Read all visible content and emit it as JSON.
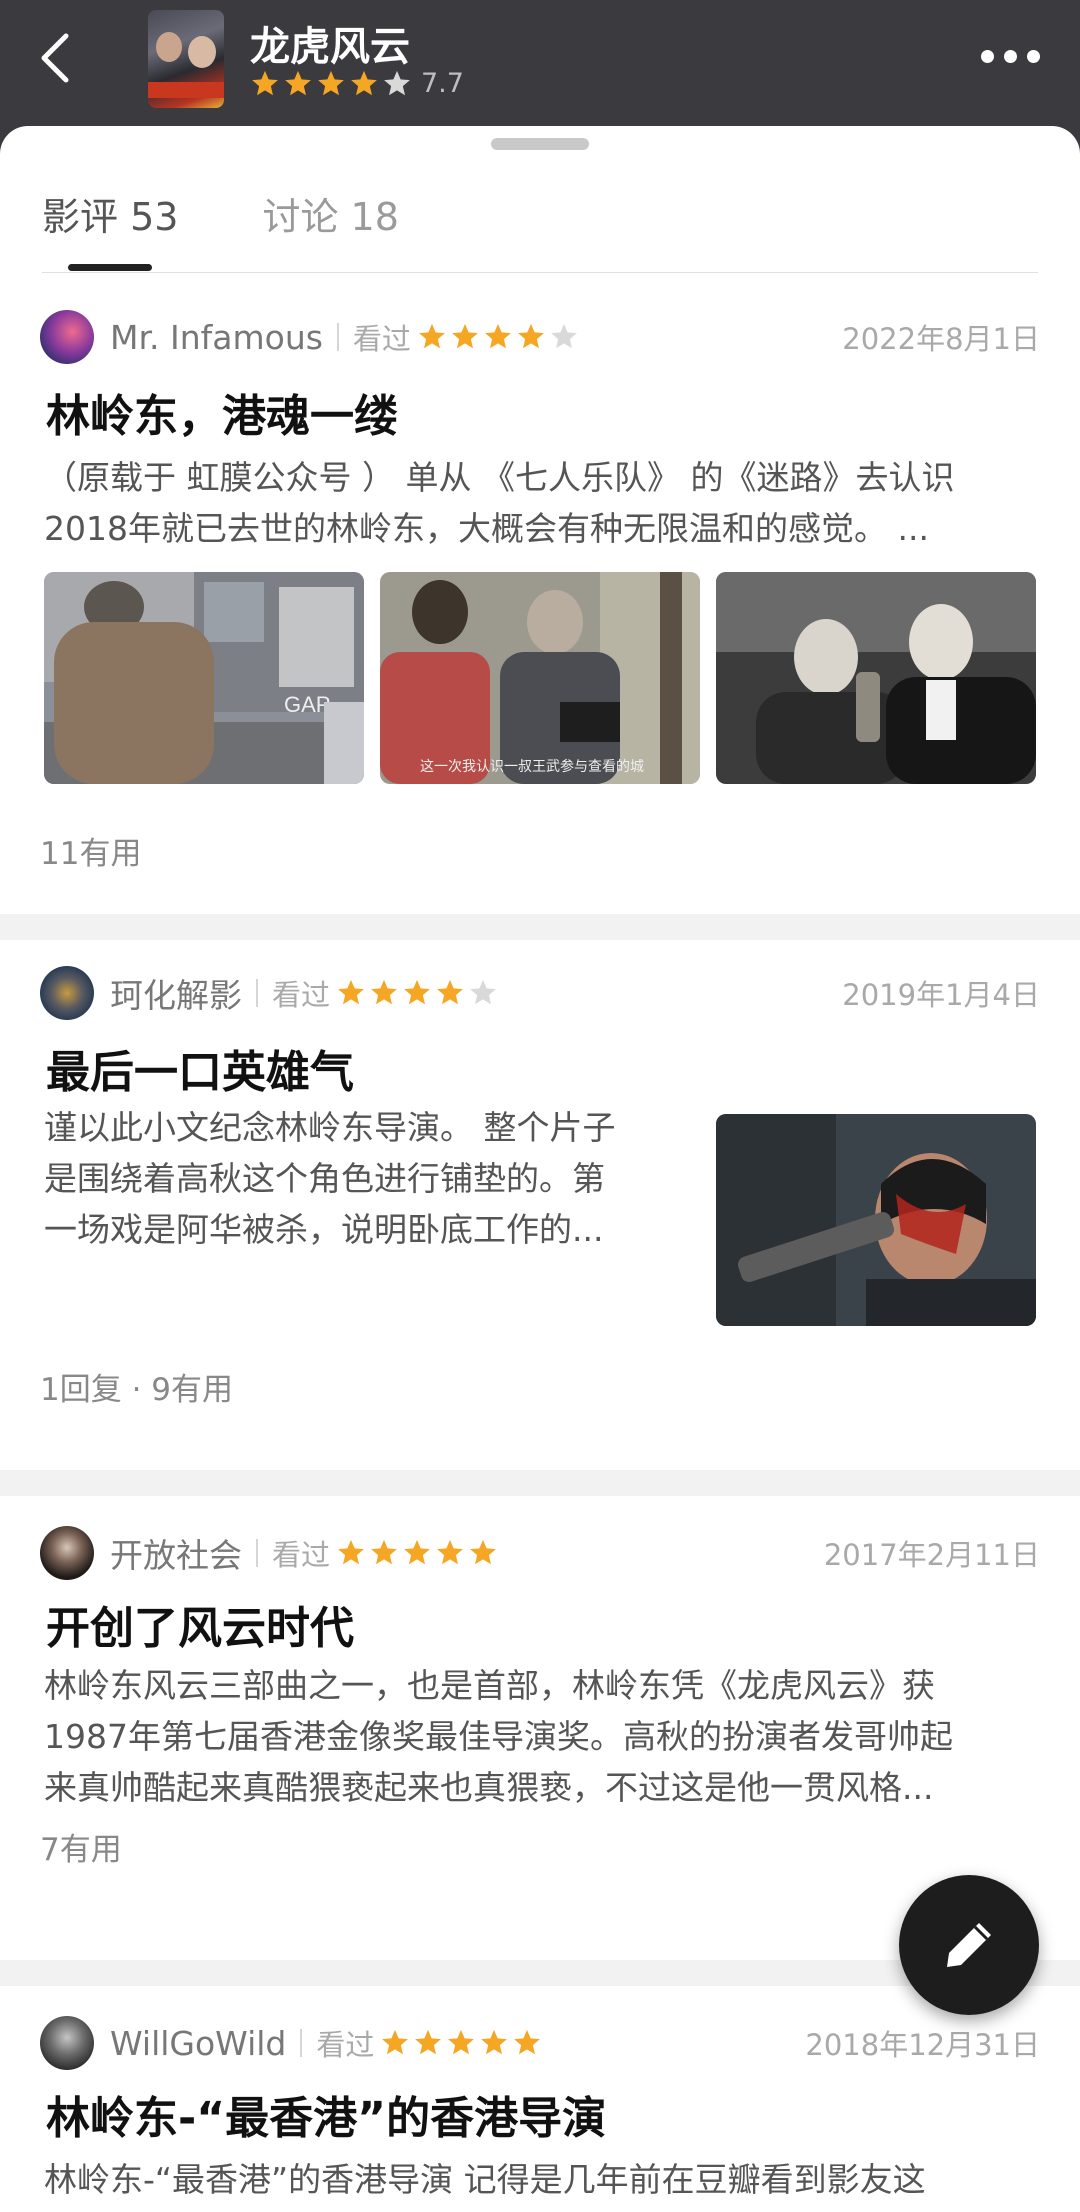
{
  "header": {
    "title": "龙虎风云",
    "rating": "7.7",
    "rating_stars": 4
  },
  "tabs": [
    {
      "label": "影评 53",
      "active": true
    },
    {
      "label": "讨论 18",
      "active": false
    }
  ],
  "reviews": [
    {
      "user": "Mr. Infamous",
      "status": "看过",
      "stars": 4,
      "date": "2022年8月1日",
      "title": "林岭东，港魂一缕",
      "excerpt_line1": "（原载于 虹膜公众号 ） 单从 《七人乐队》 的《迷路》去认识",
      "excerpt_line2": "2018年就已去世的林岭东，大概会有种无限温和的感觉。 ...",
      "image_caption": "这一次我认识一叔王武参与查看的城",
      "footer": "11有用"
    },
    {
      "user": "珂化解影",
      "status": "看过",
      "stars": 4,
      "date": "2019年1月4日",
      "title": "最后一口英雄气",
      "excerpt_line1": "谨以此小文纪念林岭东导演。 整个片子",
      "excerpt_line2": "是围绕着高秋这个角色进行铺垫的。第",
      "excerpt_line3": "一场戏是阿华被杀，说明卧底工作的...",
      "footer": "1回复 · 9有用"
    },
    {
      "user": "开放社会",
      "status": "看过",
      "stars": 5,
      "date": "2017年2月11日",
      "title": "开创了风云时代",
      "excerpt_line1": "林岭东风云三部曲之一，也是首部，林岭东凭《龙虎风云》获",
      "excerpt_line2": "1987年第七届香港金像奖最佳导演奖。高秋的扮演者发哥帅起",
      "excerpt_line3": "来真帅酷起来真酷猥亵起来也真猥亵，不过这是他一贯风格...",
      "footer": "7有用"
    },
    {
      "user": "WillGoWild",
      "status": "看过",
      "stars": 5,
      "date": "2018年12月31日",
      "title": "林岭东-“最香港”的香港导演",
      "excerpt_line1": "林岭东-“最香港”的香港导演 记得是几年前在豆瓣看到影友这"
    }
  ],
  "colors": {
    "header_bg": "#3a3a3f",
    "star_on": "#f5a623",
    "star_off": "#d9d9d9",
    "fab_bg": "#1d1d1d"
  },
  "icons": {
    "back": "chevron-left-icon",
    "more": "more-horizontal-icon",
    "fab": "pencil-icon"
  }
}
